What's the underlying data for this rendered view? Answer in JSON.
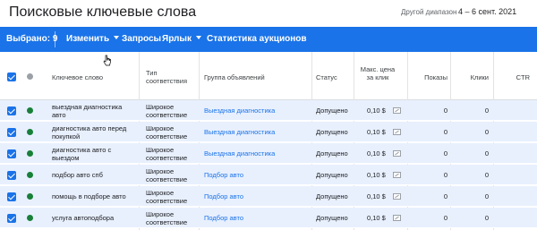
{
  "header": {
    "title": "Поисковые ключевые слова",
    "date_label": "Другой диапазон",
    "date_range": "4 – 6 сент. 2021"
  },
  "toolbar": {
    "selected_label": "Выбрано: 9",
    "edit_label": "Изменить",
    "queries_label": "Запросы",
    "label_label": "Ярлык",
    "auction_label": "Статистика аукционов"
  },
  "colors": {
    "accent": "#1a73e8",
    "status_enabled": "#188038",
    "status_all": "#9aa0a6"
  },
  "table": {
    "headers": {
      "keyword": "Ключевое слово",
      "match_type": "Тип соответствия",
      "ad_group": "Группа объявлений",
      "status": "Статус",
      "max_cpc": "Макс. цена за клик",
      "impressions": "Показы",
      "clicks": "Клики",
      "ctr": "CTR"
    },
    "rows": [
      {
        "keyword": "выездная диагностика авто",
        "match_type": "Широкое соответствие",
        "ad_group": "Выездная диагностика",
        "status": "Допущено",
        "max_cpc": "0,10 $",
        "impressions": "0",
        "clicks": "0"
      },
      {
        "keyword": "диагностика авто перед покупкой",
        "match_type": "Широкое соответствие",
        "ad_group": "Выездная диагностика",
        "status": "Допущено",
        "max_cpc": "0,10 $",
        "impressions": "0",
        "clicks": "0"
      },
      {
        "keyword": "диагностика авто с выездом",
        "match_type": "Широкое соответствие",
        "ad_group": "Выездная диагностика",
        "status": "Допущено",
        "max_cpc": "0,10 $",
        "impressions": "0",
        "clicks": "0"
      },
      {
        "keyword": "подбор авто спб",
        "match_type": "Широкое соответствие",
        "ad_group": "Подбор авто",
        "status": "Допущено",
        "max_cpc": "0,10 $",
        "impressions": "0",
        "clicks": "0"
      },
      {
        "keyword": "помощь в подборе авто",
        "match_type": "Широкое соответствие",
        "ad_group": "Подбор авто",
        "status": "Допущено",
        "max_cpc": "0,10 $",
        "impressions": "0",
        "clicks": "0"
      },
      {
        "keyword": "услуга автоподбора",
        "match_type": "Широкое соответствие",
        "ad_group": "Подбор авто",
        "status": "Допущено",
        "max_cpc": "0,10 $",
        "impressions": "0",
        "clicks": "0"
      }
    ]
  }
}
